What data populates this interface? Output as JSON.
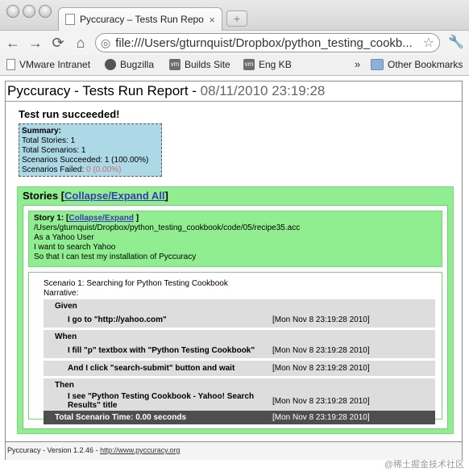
{
  "browser": {
    "tab_title": "Pyccuracy – Tests Run Report",
    "tab_close": "×",
    "new_tab": "+",
    "back_label": "←",
    "forward_label": "→",
    "reload_label": "⟳",
    "home_label": "⌂",
    "url": "file:///Users/gturnquist/Dropbox/python_testing_cookb...",
    "bookmarks": [
      {
        "label": "VMware Intranet",
        "icon": "doc-icon"
      },
      {
        "label": "Bugzilla",
        "icon": "bug-icon"
      },
      {
        "label": "Builds Site",
        "icon": "vm-icon"
      },
      {
        "label": "Eng KB",
        "icon": "vm-icon"
      }
    ],
    "bookmarks_overflow": "»",
    "other_bookmarks": "Other Bookmarks"
  },
  "report": {
    "title": "Pyccuracy - Tests Run Report - ",
    "date": "08/11/2010 23:19:28",
    "status": "Test run succeeded!",
    "summary": {
      "title": "Summary:",
      "total_stories": "Total Stories: 1",
      "total_scenarios": "Total Scenarios: 1",
      "succeeded_label": "Scenarios Succeeded: ",
      "succeeded_value": "1 (100.00%)",
      "failed_label": "Scenarios Failed: ",
      "failed_value": "0 (0.00%)"
    },
    "stories_label": "Stories",
    "stories_open_bracket": " [",
    "collapse_all": "Collapse/Expand All",
    "stories_close_bracket": "]",
    "story": {
      "label": "Story 1: ",
      "open_bracket": "[",
      "collapse": "Collapse/Expand",
      "close_bracket": " ]",
      "path": "/Users/gturnquist/Dropbox/python_testing_cookbook/code/05/recipe35.acc",
      "as_a": "As a Yahoo User",
      "i_want": "I want to search Yahoo",
      "so_that": "So that I can test my installation of Pyccuracy"
    },
    "scenario": {
      "label": "Scenario 1: ",
      "title": "Searching for Python Testing Cookbook",
      "narrative": "Narrative:",
      "given": "Given",
      "when": "When",
      "then": "Then",
      "steps": [
        {
          "text": "I go to \"http://yahoo.com\"",
          "time": "[Mon Nov 8 23:19:28 2010]"
        },
        {
          "text": "I fill \"p\" textbox with \"Python Testing Cookbook\"",
          "time": "[Mon Nov 8 23:19:28 2010]"
        },
        {
          "text": "And I click \"search-submit\" button and wait",
          "time": "[Mon Nov 8 23:19:28 2010]"
        },
        {
          "text": "I see \"Python Testing Cookbook - Yahoo! Search Results\" title",
          "time": "[Mon Nov 8 23:19:28 2010]"
        }
      ],
      "total_label": "Total Scenario Time:  0.00  seconds",
      "total_time": "[Mon Nov 8 23:19:28 2010]"
    },
    "footer_text": "Pyccuracy - Version 1.2.46 - ",
    "footer_link": "http://www.pyccuracy.org"
  },
  "watermark": "@稀土掘金技术社区"
}
